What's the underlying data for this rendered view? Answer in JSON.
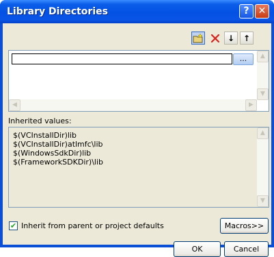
{
  "window": {
    "title": "Library Directories"
  },
  "title_buttons": {
    "help": "?",
    "close": "✕"
  },
  "toolbar": {
    "browse_label": "...",
    "down_arrow": "↓",
    "up_arrow": "↑"
  },
  "scroll": {
    "up": "▲",
    "down": "▼",
    "left": "◀",
    "right": "▶"
  },
  "inherited": {
    "label": "Inherited values:",
    "lines": [
      "$(VCInstallDir)lib",
      "$(VCInstallDir)atlmfc\\lib",
      "$(WindowsSdkDir)lib",
      "$(FrameworkSDKDir)\\lib"
    ]
  },
  "checkbox": {
    "label": "Inherit from parent or project defaults",
    "checked_glyph": "✔"
  },
  "buttons": {
    "macros": "Macros>>",
    "ok": "OK",
    "cancel": "Cancel"
  },
  "colors": {
    "title_bar": "#0451e4",
    "dialog_bg": "#ece9d8",
    "close_btn": "#c73d14"
  }
}
